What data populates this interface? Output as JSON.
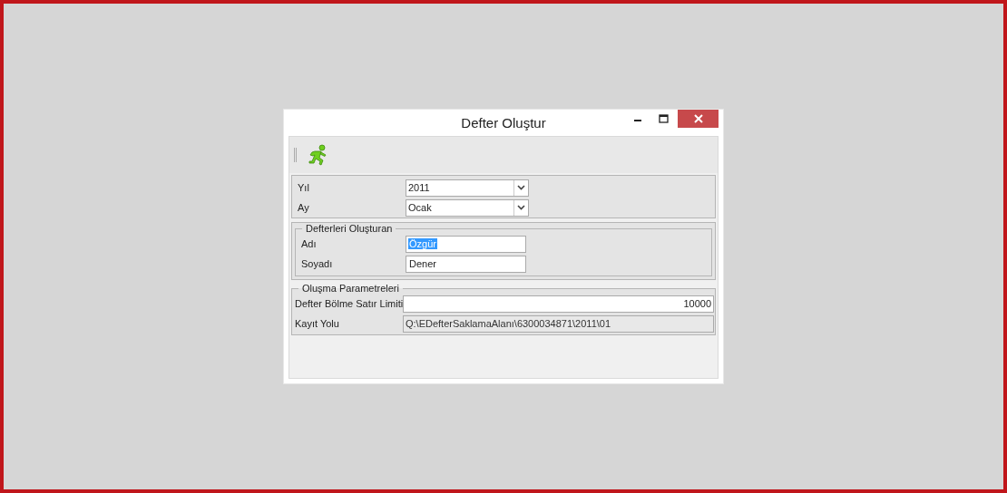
{
  "window": {
    "title": "Defter Oluştur"
  },
  "period": [
    {
      "label": "Yıl",
      "value": "2011"
    },
    {
      "label": "Ay",
      "value": "Ocak"
    }
  ],
  "creator": {
    "title": "Defterleri Oluşturan",
    "fields": [
      {
        "label": "Adı",
        "value": "Özgür",
        "selected": true
      },
      {
        "label": "Soyadı",
        "value": "Dener",
        "selected": false
      }
    ]
  },
  "parameters": {
    "title": "Oluşma Parametreleri",
    "fields": [
      {
        "label": "Defter Bölme Satır Limiti",
        "value": "10000",
        "kind": "number",
        "disabled": false
      },
      {
        "label": "Kayıt Yolu",
        "value": "Q:\\EDefterSaklamaAlanı\\6300034871\\2011\\01",
        "kind": "path",
        "disabled": true
      }
    ]
  }
}
